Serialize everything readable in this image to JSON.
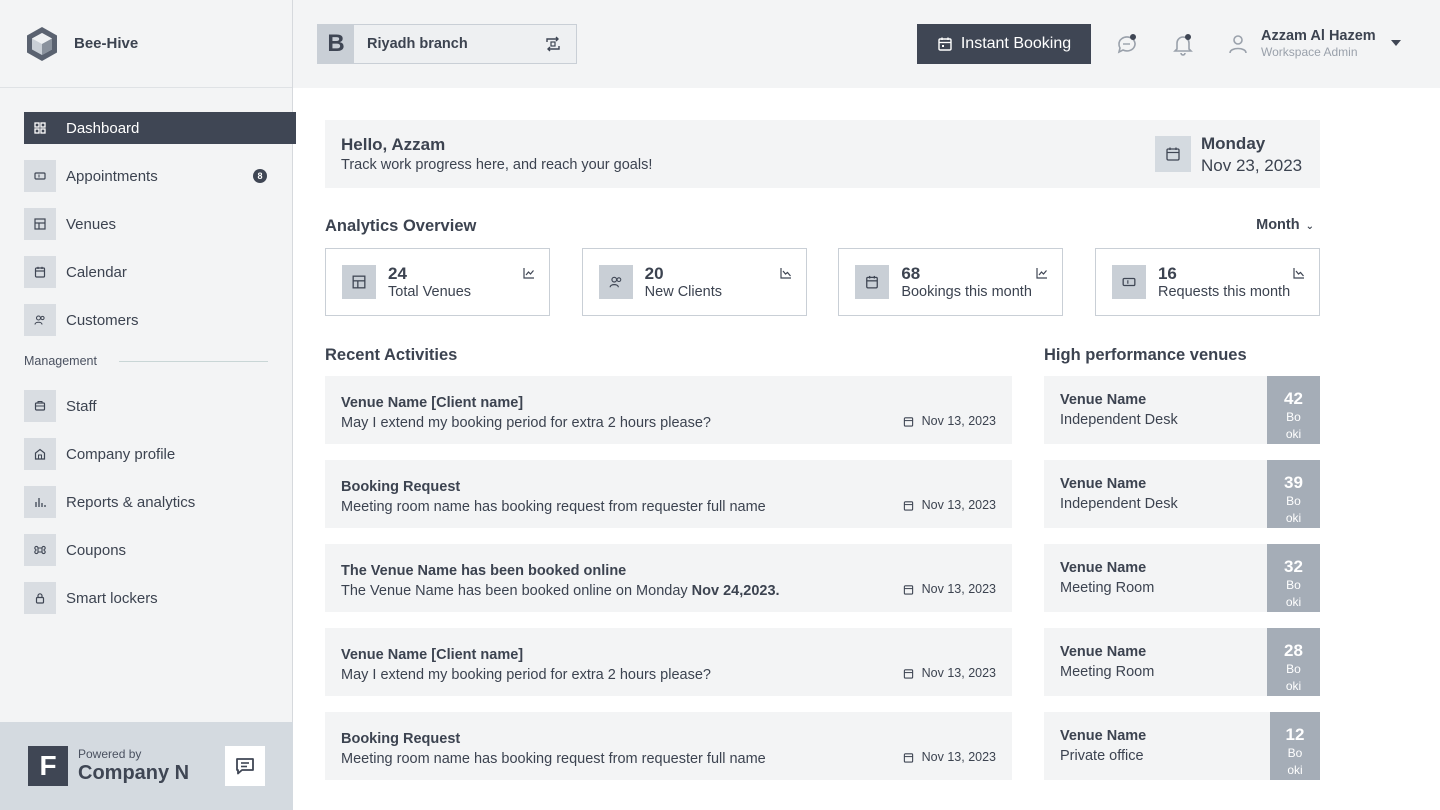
{
  "brand": {
    "name": "Bee-Hive"
  },
  "sidebar": {
    "items": [
      {
        "label": "Dashboard",
        "icon": "grid-icon",
        "active": true
      },
      {
        "label": "Appointments",
        "icon": "ticket-icon",
        "badge": "8"
      },
      {
        "label": "Venues",
        "icon": "layout-icon"
      },
      {
        "label": "Calendar",
        "icon": "calendar-icon"
      },
      {
        "label": "Customers",
        "icon": "users-icon"
      }
    ],
    "section_label": "Management",
    "management_items": [
      {
        "label": "Staff",
        "icon": "staff-icon"
      },
      {
        "label": "Company profile",
        "icon": "building-icon"
      },
      {
        "label": "Reports & analytics",
        "icon": "bar-chart-icon"
      },
      {
        "label": "Coupons",
        "icon": "command-icon"
      },
      {
        "label": "Smart lockers",
        "icon": "lock-icon"
      }
    ],
    "powered_by": "Powered by",
    "company": "Company N",
    "powered_logo": "F"
  },
  "header": {
    "branch_letter": "B",
    "branch_name": "Riyadh branch",
    "instant_booking": "Instant Booking",
    "user_name": "Azzam Al Hazem",
    "user_role": "Workspace Admin"
  },
  "greeting": {
    "title": "Hello, Azzam",
    "subtitle": "Track work progress here, and reach your goals!",
    "day": "Monday",
    "date": "Nov 23, 2023"
  },
  "analytics": {
    "title": "Analytics Overview",
    "period": "Month",
    "cards": [
      {
        "value": "24",
        "label": "Total Venues",
        "icon": "layout-icon"
      },
      {
        "value": "20",
        "label": "New Clients",
        "icon": "users-icon"
      },
      {
        "value": "68",
        "label": "Bookings this month",
        "icon": "calendar-icon"
      },
      {
        "value": "16",
        "label": "Requests this month",
        "icon": "ticket-icon"
      }
    ]
  },
  "recent": {
    "title": "Recent Activities",
    "items": [
      {
        "title": "Venue Name [Client name]",
        "desc": "May I extend my booking period for extra 2 hours please?",
        "desc_bold": "",
        "date": "Nov 13, 2023"
      },
      {
        "title": "Booking Request",
        "desc": "Meeting room name has booking request from requester full name",
        "desc_bold": "",
        "date": "Nov 13, 2023"
      },
      {
        "title": "The Venue Name has been booked online",
        "desc": "The Venue Name has been booked online on Monday ",
        "desc_bold": "Nov 24,2023.",
        "date": "Nov 13, 2023"
      },
      {
        "title": "Venue Name [Client name]",
        "desc": "May I extend my booking period for extra 2 hours please?",
        "desc_bold": "",
        "date": "Nov 13, 2023"
      },
      {
        "title": "Booking Request",
        "desc": "Meeting room name has booking request from requester full name",
        "desc_bold": "",
        "date": "Nov 13, 2023"
      }
    ]
  },
  "high_performance": {
    "title": "High performance venues",
    "items": [
      {
        "name": "Venue Name",
        "type": "Independent Desk",
        "count": "42",
        "unit": "Booki"
      },
      {
        "name": "Venue Name",
        "type": "Independent Desk",
        "count": "39",
        "unit": "Booki"
      },
      {
        "name": "Venue Name",
        "type": "Meeting Room",
        "count": "32",
        "unit": "Booki"
      },
      {
        "name": "Venue Name",
        "type": "Meeting Room",
        "count": "28",
        "unit": "Booki"
      },
      {
        "name": "Venue Name",
        "type": "Private office",
        "count": "12",
        "unit": "Booki"
      }
    ]
  },
  "colors": {
    "primary": "#3f4654",
    "surface": "#f3f4f5",
    "accent_muted": "#a5adb7"
  }
}
